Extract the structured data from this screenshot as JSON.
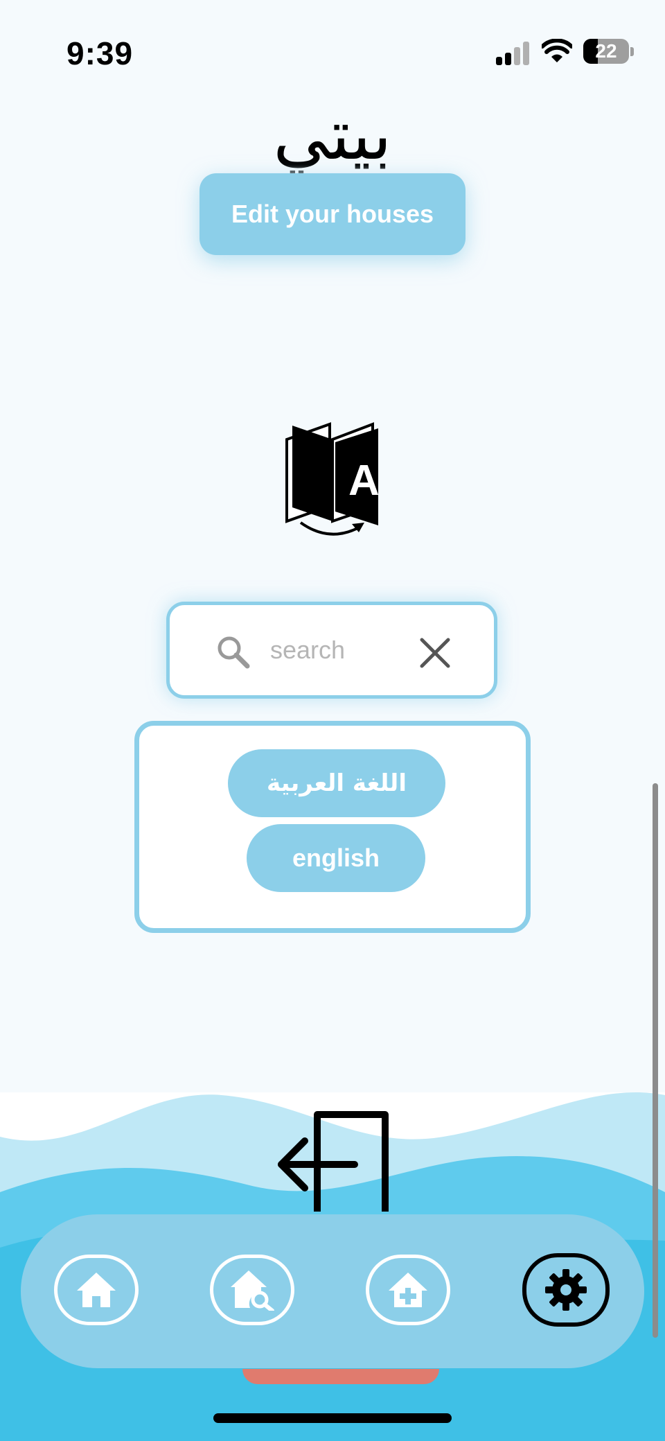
{
  "status_bar": {
    "time": "9:39",
    "battery": "22"
  },
  "app": {
    "logo": "بيتي"
  },
  "header": {
    "edit_button_label": "Edit your houses"
  },
  "search": {
    "placeholder": "search"
  },
  "languages": {
    "arabic": "اللغة العربية",
    "english": "english"
  },
  "nav": {
    "items": [
      {
        "icon": "home-icon"
      },
      {
        "icon": "house-search-icon"
      },
      {
        "icon": "house-add-icon"
      },
      {
        "icon": "gear-icon",
        "active": true
      }
    ]
  },
  "colors": {
    "accent": "#8ccfe9",
    "wave_dark": "#3fc0e6",
    "wave_light": "#bfe8f6",
    "indicator": "#e07b6e"
  }
}
